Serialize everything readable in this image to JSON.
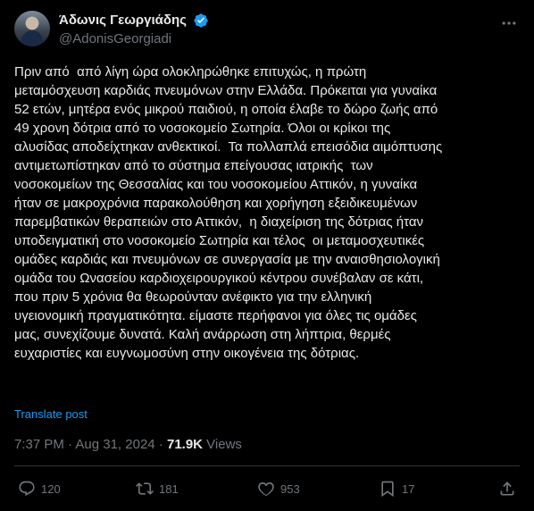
{
  "author": {
    "display_name": "Άδωνις Γεωργιάδης",
    "handle": "@AdonisGeorgiadi",
    "verified_icon": "verified-badge-icon",
    "avatar": "avatar"
  },
  "tweet": {
    "text": "Πριν από  από λίγη ώρα ολοκληρώθηκε επιτυχώς, η πρώτη\nμεταμόσχευση καρδιάς πνευμόνων στην Ελλάδα. Πρόκειται για γυναίκα\n52 ετών, μητέρα ενός μικρού παιδιού, η οποία έλαβε το δώρο ζωής από\n49 χρονη δότρια από το νοσοκομείο Σωτηρία. Όλοι οι κρίκοι της\nαλυσίδας αποδείχτηκαν ανθεκτικοί.  Τα πολλαπλά επεισόδια αιμόπτυσης\nαντιμετωπίστηκαν από το σύστημα επείγουσας ιατρικής  των\nνοσοκομείων της Θεσσαλίας και του νοσοκομείου Αττικόν, η γυναίκα\nήταν σε μακροχρόνια παρακολούθηση και χορήγηση εξειδικευμένων\nπαρεμβατικών θεραπειών στο Αττικόν,  η διαχείριση της δότριας ήταν\nυποδειγματική στο νοσοκομείο Σωτηρία και τέλος  οι μεταμοσχευτικές\nομάδες καρδιάς και πνευμόνων σε συνεργασία με την αναισθησιολογική\nομάδα του Ωνασείου καρδιοχειρουργικού κέντρου συνέβαλαν σε κάτι,\nπου πριν 5 χρόνια θα θεωρούνταν ανέφικτο για την ελληνική\nυγειονομική πραγματικότητα. είμαστε περήφανοι για όλες τις ομάδες\nμας, συνεχίζουμε δυνατά. Καλή ανάρρωση στη λήπτρια, θερμές\nευχαριστίες και ευγνωμοσύνη στην οικογένεια της δότριας.",
    "translate_label": "Translate post"
  },
  "meta": {
    "time": "7:37 PM",
    "separator": " · ",
    "date": "Aug 31, 2024",
    "views_count": "71.9K",
    "views_label": " Views"
  },
  "actions": {
    "replies": "120",
    "reposts": "181",
    "likes": "953",
    "bookmarks": "17"
  },
  "colors": {
    "background": "#000000",
    "text": "#e7e9ea",
    "secondary": "#71767b",
    "link": "#1d9bf0",
    "divider": "#2f3336"
  }
}
